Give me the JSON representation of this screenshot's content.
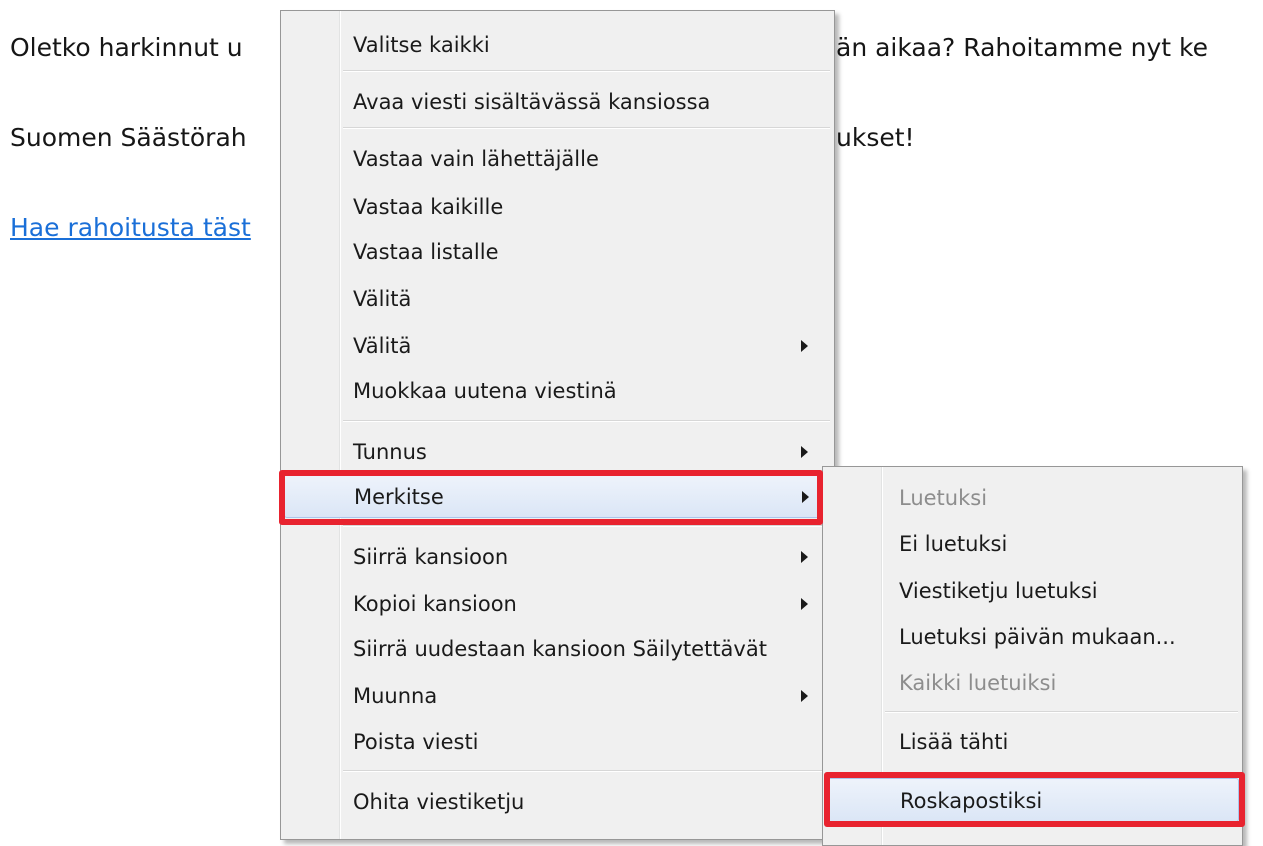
{
  "email": {
    "line1_start": "Oletko harkinnut u",
    "line1_end": "än aikaa? Rahoitamme nyt ke",
    "line2_start": "Suomen Säästörah",
    "line2_end": "ukset!",
    "link_text": "Hae rahoitusta täst"
  },
  "context_menu": {
    "items": [
      {
        "label": "Valitse kaikki"
      },
      {
        "label": "Avaa viesti sisältävässä kansiossa"
      },
      {
        "label": "Vastaa vain lähettäjälle"
      },
      {
        "label": "Vastaa kaikille"
      },
      {
        "label": "Vastaa listalle"
      },
      {
        "label": "Välitä"
      },
      {
        "label": "Välitä"
      },
      {
        "label": "Muokkaa uutena viestinä"
      },
      {
        "label": "Tunnus"
      },
      {
        "label": "Merkitse"
      },
      {
        "label": "Siirrä kansioon"
      },
      {
        "label": "Kopioi kansioon"
      },
      {
        "label": "Siirrä uudestaan kansioon Säilytettävät"
      },
      {
        "label": "Muunna"
      },
      {
        "label": "Poista viesti"
      },
      {
        "label": "Ohita viestiketju"
      }
    ]
  },
  "submenu": {
    "items": [
      {
        "label": "Luetuksi",
        "disabled": true
      },
      {
        "label": "Ei luetuksi"
      },
      {
        "label": "Viestiketju luetuksi"
      },
      {
        "label": "Luetuksi päivän mukaan..."
      },
      {
        "label": "Kaikki luetuiksi",
        "disabled": true
      },
      {
        "label": "Lisää tähti"
      },
      {
        "label": "Roskapostiksi"
      }
    ]
  },
  "colors": {
    "highlight_box": "#e8232f",
    "link": "#1a6fd8",
    "menu_background": "#f0f0f0",
    "disabled_text": "#8d8d8d"
  }
}
